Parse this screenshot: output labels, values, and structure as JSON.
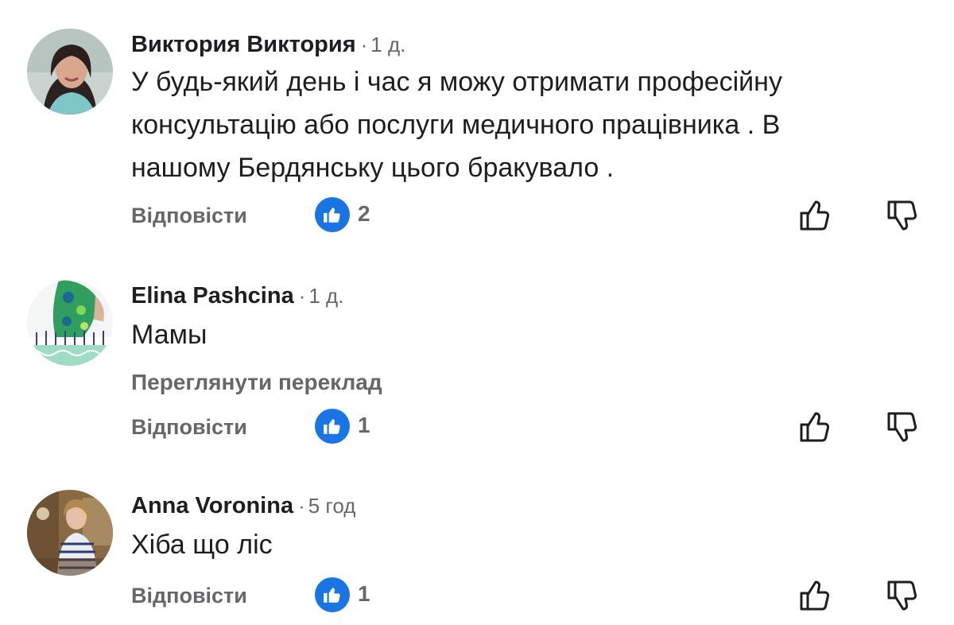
{
  "comments": [
    {
      "author": "Виктория Виктория",
      "separator": "·",
      "time": "1 д.",
      "text": "У будь-який день і час я можу отримати професійну\nконсультацію або послуги медичного працівника . В\nнашому Бердянську  цього бракувало .",
      "reply_label": "Відповісти",
      "like_count": "2",
      "translate_label": ""
    },
    {
      "author": "Elina Pashcina",
      "separator": "·",
      "time": "1 д.",
      "text": "Мамы",
      "translate_label": "Переглянути переклад",
      "reply_label": "Відповісти",
      "like_count": "1"
    },
    {
      "author": "Anna Voronina",
      "separator": "·",
      "time": "5 год",
      "text": "Хіба що ліс",
      "reply_label": "Відповісти",
      "like_count": "1",
      "translate_label": ""
    }
  ],
  "icons": {
    "like_badge": "thumbs-up-icon",
    "like": "thumbs-up-outline-icon",
    "dislike": "thumbs-down-outline-icon"
  },
  "colors": {
    "like_badge": "#1b74e4",
    "secondary_text": "#65676b",
    "primary_text": "#1c1e21"
  }
}
